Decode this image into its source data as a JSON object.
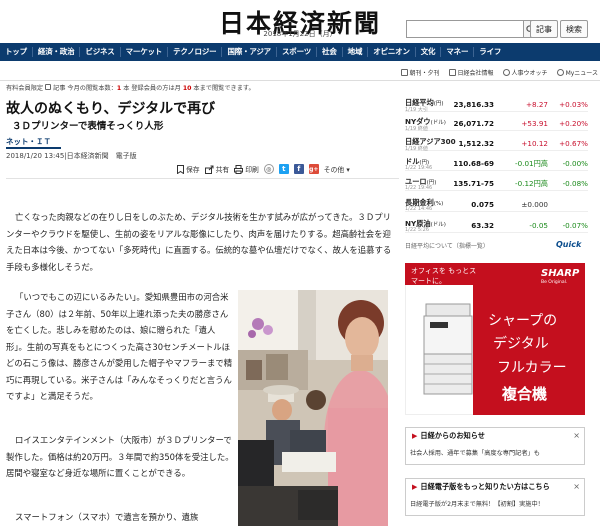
{
  "header": {
    "logo": "日本経済新聞",
    "date": "2018年1月22日（月）",
    "search_placeholder": "",
    "buttons": [
      "記事",
      "検索"
    ]
  },
  "nav": {
    "items": [
      "トップ",
      "経済・政治",
      "ビジネス",
      "マーケット",
      "テクノロジー",
      "国際・アジア",
      "スポーツ",
      "社会",
      "地域",
      "オピニオン",
      "文化",
      "マネー",
      "ライフ"
    ]
  },
  "subnav": {
    "items": [
      "朝刊・夕刊",
      "日経会社情報",
      "人事ウオッチ",
      "Myニュース"
    ]
  },
  "article": {
    "meta_prefix": "有料会員限定",
    "meta_body": "記事 今月の閲覧本数：",
    "meta_count": "1",
    "meta_mid": "本 登録会員の方は月",
    "meta_limit": "10",
    "meta_suffix": "本まで閲覧できます。",
    "headline": "故人のぬくもり、デジタルで再び",
    "subheadline": "３Ｄプリンターで表情そっくり人形",
    "category": "ネット・ＩＴ",
    "datetime": "2018/1/20 13:45",
    "source": "日本経済新聞　電子版",
    "share": {
      "save": "保存",
      "share": "共有",
      "print": "印刷",
      "more": "その他"
    },
    "paragraphs": [
      "亡くなった肉親などの在りし日をしのぶため、デジタル技術を生かす試みが広がってきた。３Ｄプリンターやクラウドを駆使し、生前の姿をリアルな彫像にしたり、肉声を届けたりする。超高齢社会を迎えた日本は今後、かつてない「多死時代」に直面する。伝統的な墓や仏壇だけでなく、故人を追慕する手段も多様化しそうだ。",
      "「いつでもこの辺にいるみたい」。愛知県豊田市の河合米子さん（80）は２年前、50年以上連れ添った夫の勝彦さんを亡くした。悲しみを慰めたのは、娘に贈られた「遺人形」。生前の写真をもとにつくった高さ30センチメートルほどの石こう像は、勝彦さんが愛用した帽子やマフラーまで精巧に再現している。米子さんは「みんなそっくりだと言うんですよ」と満足そうだ。",
      "ロイスエンタテインメント（大阪市）が３Ｄプリンターで製作した。価格は約20万円。３年間で約350体を受注した。居間や寝室など身近な場所に置くことができる。",
      "スマートフォン（スマホ）で遺言を預かり、遺族"
    ]
  },
  "market": {
    "rows": [
      {
        "name": "日経平均",
        "unit": "(円)",
        "date": "1/19 大引",
        "value": "23,816.33",
        "change": "+8.27",
        "pct": "+0.03%",
        "dir": "up"
      },
      {
        "name": "NYダウ",
        "unit": "(ドル)",
        "date": "1/19 終値",
        "value": "26,071.72",
        "change": "+53.91",
        "pct": "+0.20%",
        "dir": "up"
      },
      {
        "name": "日経アジア300",
        "unit": "",
        "date": "1/19 終値",
        "value": "1,512.32",
        "change": "+10.12",
        "pct": "+0.67%",
        "dir": "up"
      },
      {
        "name": "ドル",
        "unit": "(円)",
        "date": "1/22 19:46",
        "value": "110.68-69",
        "change": "-0.01円高",
        "pct": "-0.00%",
        "dir": "dn"
      },
      {
        "name": "ユーロ",
        "unit": "(円)",
        "date": "1/22 19:46",
        "value": "135.71-75",
        "change": "-0.12円高",
        "pct": "-0.08%",
        "dir": "dn"
      },
      {
        "name": "長期金利",
        "unit": "(%)",
        "date": "1/22 14:46",
        "value": "0.075",
        "change": "±0.000",
        "pct": "",
        "dir": "nc"
      },
      {
        "name": "NY原油",
        "unit": "(ドル)",
        "date": "1/22 5:26",
        "value": "63.32",
        "change": "-0.05",
        "pct": "-0.07%",
        "dir": "dn"
      }
    ],
    "note": "日経平均について（指標一覧）",
    "brand": "Quick"
  },
  "ad": {
    "tagline": "オフィスを もっとスマートに。",
    "brand": "SHARP",
    "brand_sub": "Be Original.",
    "lines": [
      "シャープの",
      "デジタル",
      "フルカラー",
      "複合機"
    ]
  },
  "sidebar": {
    "box1_title": "日経からのお知らせ",
    "box1_text": "社会人採用、通年で募集「高度な専門記者」も",
    "box2_title": "日経電子版をもっと知りたい方はこちら",
    "box2_text": "日経電子版が2月末まで無料！【初割】実施中！"
  },
  "colors": {
    "nav_bg": "#0c3b6e",
    "up": "#c8102e",
    "down": "#1a8a1a",
    "ad_red": "#c40f1e"
  }
}
